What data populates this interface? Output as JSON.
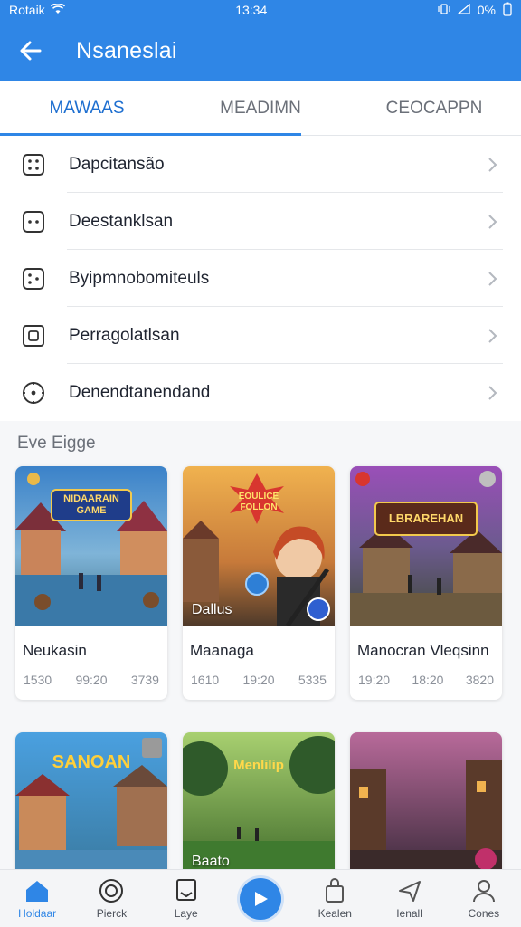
{
  "status_bar": {
    "carrier": "Rotaik",
    "time": "13:34",
    "battery": "0%"
  },
  "app_bar": {
    "title": "Nsaneslai"
  },
  "tabs": [
    {
      "label": "MAWAAS",
      "active": true
    },
    {
      "label": "MEADIMN",
      "active": false
    },
    {
      "label": "CEOCAPPN",
      "active": false
    }
  ],
  "list": [
    {
      "label": "Dapcitansão",
      "icon": "dice-four-icon"
    },
    {
      "label": "Deestanklsan",
      "icon": "dice-two-icon"
    },
    {
      "label": "Byipmnobomiteuls",
      "icon": "dice-three-icon"
    },
    {
      "label": "Perragolatlsan",
      "icon": "frame-icon"
    },
    {
      "label": "Denendtanendand",
      "icon": "target-icon"
    }
  ],
  "section": {
    "title": "Eve Eigge"
  },
  "cards": [
    {
      "banner": "NIDAARAIN GAME",
      "name": "Neukasin",
      "stats": [
        "1530",
        "99:20",
        "3739"
      ],
      "overlay": ""
    },
    {
      "banner": "EOULICE FOLLON",
      "name": "Maanaga",
      "stats": [
        "1610",
        "19:20",
        "5335"
      ],
      "overlay": "Dallus"
    },
    {
      "banner": "LBRAREHAN",
      "name": "Manocran Vleqsinn",
      "stats": [
        "19:20",
        "18:20",
        "3820"
      ],
      "overlay": ""
    }
  ],
  "cards_row2": [
    {
      "banner": "SANOAN",
      "overlay": ""
    },
    {
      "banner": "Menlilip",
      "overlay": "Baato"
    },
    {
      "banner": "",
      "overlay": ""
    }
  ],
  "bottom_nav": [
    {
      "label": "Holdaar",
      "icon": "home-icon",
      "active": true
    },
    {
      "label": "Pierck",
      "icon": "compass-icon",
      "active": false
    },
    {
      "label": "Laye",
      "icon": "bookmark-icon",
      "active": false
    },
    {
      "label": "",
      "icon": "play-icon",
      "active": false
    },
    {
      "label": "Kealen",
      "icon": "bag-icon",
      "active": false
    },
    {
      "label": "Ienall",
      "icon": "send-icon",
      "active": false
    },
    {
      "label": "Cones",
      "icon": "person-icon",
      "active": false
    }
  ],
  "colors": {
    "primary": "#2f86e6",
    "active_tab": "#1e6fd0",
    "background": "#f6f7f9"
  }
}
